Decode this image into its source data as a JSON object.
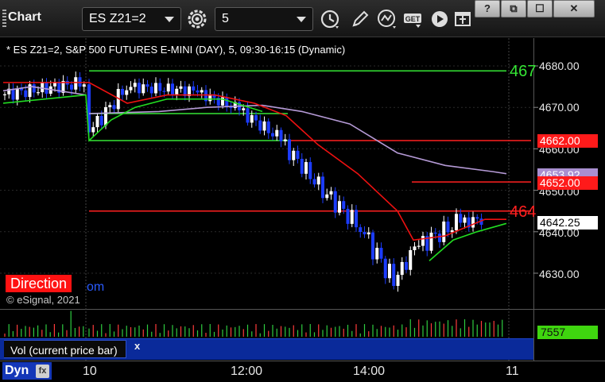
{
  "app": {
    "title": "Chart"
  },
  "toolbar": {
    "symbol_value": "ES Z21=2",
    "interval_value": "5",
    "icons": [
      "settings-gear-icon",
      "clock-icon",
      "pencil-draw-icon",
      "study-indicator-icon",
      "get-data-icon",
      "play-icon",
      "new-window-icon"
    ]
  },
  "window_controls": {
    "help": "?",
    "restore": "⧉",
    "maximize": "☐",
    "close": "✕"
  },
  "chart": {
    "header": "* ES Z21=2, S&P 500 FUTURES E-MINI (DAY), 5, 09:30-16:15 (Dynamic)",
    "direction_badge": "Direction",
    "direction_suffix": "om",
    "copyright": "© eSignal, 2021",
    "price_axis": [
      "4680.00",
      "4670.00",
      "4660.00",
      "4650.00",
      "4640.00",
      "4630.00"
    ],
    "tags": {
      "red_upper": "4662.00",
      "purple": "4653.92",
      "red_lower": "4652.00",
      "current": "4642.25"
    },
    "edge_labels": {
      "green_top": "467",
      "red_mid": "464"
    },
    "time_axis": [
      "10",
      "12:00",
      "14:00",
      "11"
    ],
    "colors": {
      "up_candle": "#ffffff",
      "down_candle": "#1c3cff",
      "ema_fast": "#22dd22",
      "ema_red": "#ee1111",
      "ma_purple": "#b59ad6",
      "level_green": "#35e635",
      "level_red": "#ff2020"
    }
  },
  "volume": {
    "label": "Vol (current price bar)",
    "close_glyph": "x",
    "value": "7557"
  },
  "status": {
    "dyn_label": "Dyn",
    "fx_label": "fx"
  },
  "chart_data": {
    "type": "line",
    "title": "* ES Z21=2, S&P 500 FUTURES E-MINI (DAY), 5, 09:30-16:15 (Dynamic)",
    "price_levels": {
      "green_level_high": 4678.8,
      "green_level_mid": 4668.5,
      "green_level_low": 4662.0,
      "red_level_high": 4662.0,
      "red_level_low": 4652.0,
      "red_level_mid": 4645.0
    },
    "last_price": 4642.25,
    "purple_ma_last": 4653.92,
    "ylim": [
      4624,
      4686
    ],
    "y_ticks": [
      4630,
      4640,
      4650,
      4660,
      4670,
      4680
    ],
    "x_ticks": [
      "10",
      "12:00",
      "14:00",
      "11"
    ],
    "volume_last": 7557
  }
}
